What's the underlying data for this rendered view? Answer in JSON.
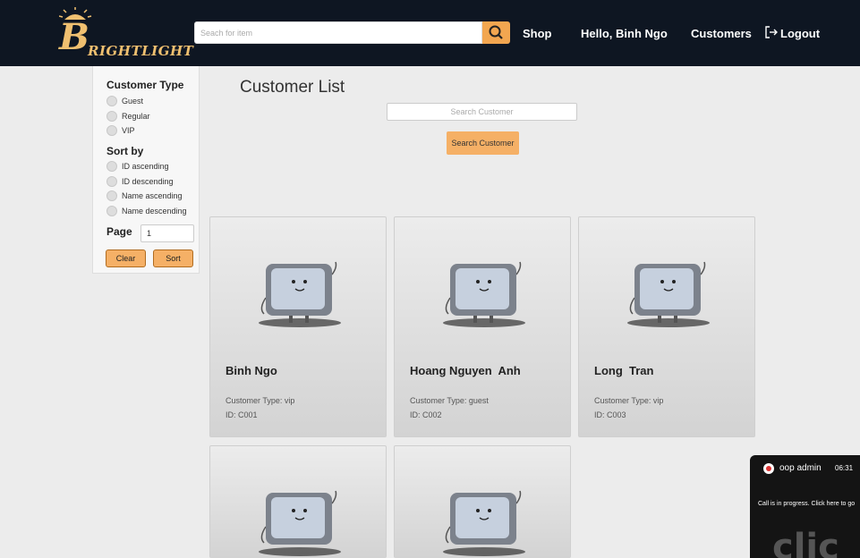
{
  "header": {
    "logo_big": "B",
    "logo_rest": "RIGHTLIGHT",
    "search_placeholder": "Seach for item",
    "nav_shop": "Shop",
    "nav_greeting": "Hello, Binh Ngo",
    "nav_customers": "Customers",
    "nav_logout": "Logout"
  },
  "sidebar": {
    "customer_type_title": "Customer Type",
    "customer_types": [
      "Guest",
      "Regular",
      "VIP"
    ],
    "sort_title": "Sort by",
    "sort_options": [
      "ID ascending",
      "ID descending",
      "Name ascending",
      "Name descending"
    ],
    "page_label": "Page",
    "page_value": "1",
    "clear_label": "Clear",
    "sort_label": "Sort"
  },
  "main": {
    "title": "Customer List",
    "search_placeholder": "Search Customer",
    "search_button": "Search Customer"
  },
  "customers": [
    {
      "name": "Binh Ngo",
      "type": "Customer Type:  vip",
      "id": "ID: C001"
    },
    {
      "name": "Hoang Nguyen  Anh",
      "type": "Customer Type:  guest",
      "id": "ID: C002"
    },
    {
      "name": "Long  Tran",
      "type": "Customer Type:  vip",
      "id": "ID: C003"
    }
  ],
  "call_popup": {
    "caller": "oop admin",
    "time": "06:31",
    "message": "Call is in progress. Click here to go",
    "watermark": "clic"
  },
  "colors": {
    "header_bg": "#0e1622",
    "accent": "#f2a650",
    "logo": "#f0c070"
  }
}
